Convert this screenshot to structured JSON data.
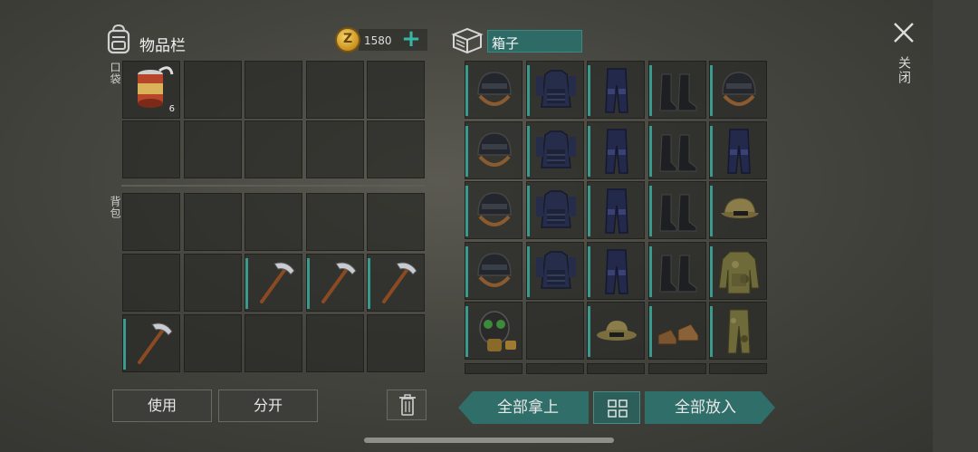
{
  "inventory": {
    "title": "物品栏",
    "pocket_label": "口袋",
    "backpack_label": "背包",
    "coins": "1580",
    "plus": "+",
    "pocket_slots": [
      {
        "item": "canned-food",
        "qty": "6"
      },
      {
        "item": ""
      },
      {
        "item": ""
      },
      {
        "item": ""
      },
      {
        "item": ""
      },
      {
        "item": ""
      },
      {
        "item": ""
      },
      {
        "item": ""
      },
      {
        "item": ""
      },
      {
        "item": ""
      }
    ],
    "backpack_slots": [
      {
        "item": ""
      },
      {
        "item": ""
      },
      {
        "item": ""
      },
      {
        "item": ""
      },
      {
        "item": ""
      },
      {
        "item": ""
      },
      {
        "item": ""
      },
      {
        "item": "pickaxe"
      },
      {
        "item": "pickaxe"
      },
      {
        "item": "pickaxe"
      },
      {
        "item": "pickaxe"
      },
      {
        "item": ""
      },
      {
        "item": ""
      },
      {
        "item": ""
      },
      {
        "item": ""
      }
    ]
  },
  "box": {
    "title": "箱子",
    "slots": [
      "helmet",
      "vest",
      "pants",
      "boots",
      "helmet",
      "helmet",
      "vest",
      "pants",
      "boots",
      "pants",
      "helmet",
      "vest",
      "pants",
      "boots",
      "cap",
      "helmet",
      "vest",
      "pants",
      "boots",
      "camo-jacket",
      "gas-mask",
      "",
      "boonie-hat",
      "shoes",
      "camo-pants"
    ]
  },
  "buttons": {
    "use": "使用",
    "split": "分开",
    "take_all": "全部拿上",
    "put_all": "全部放入"
  },
  "close_label": "关闭",
  "colors": {
    "accent_teal": "#2f6e69",
    "coin_gold": "#e0a93a"
  }
}
